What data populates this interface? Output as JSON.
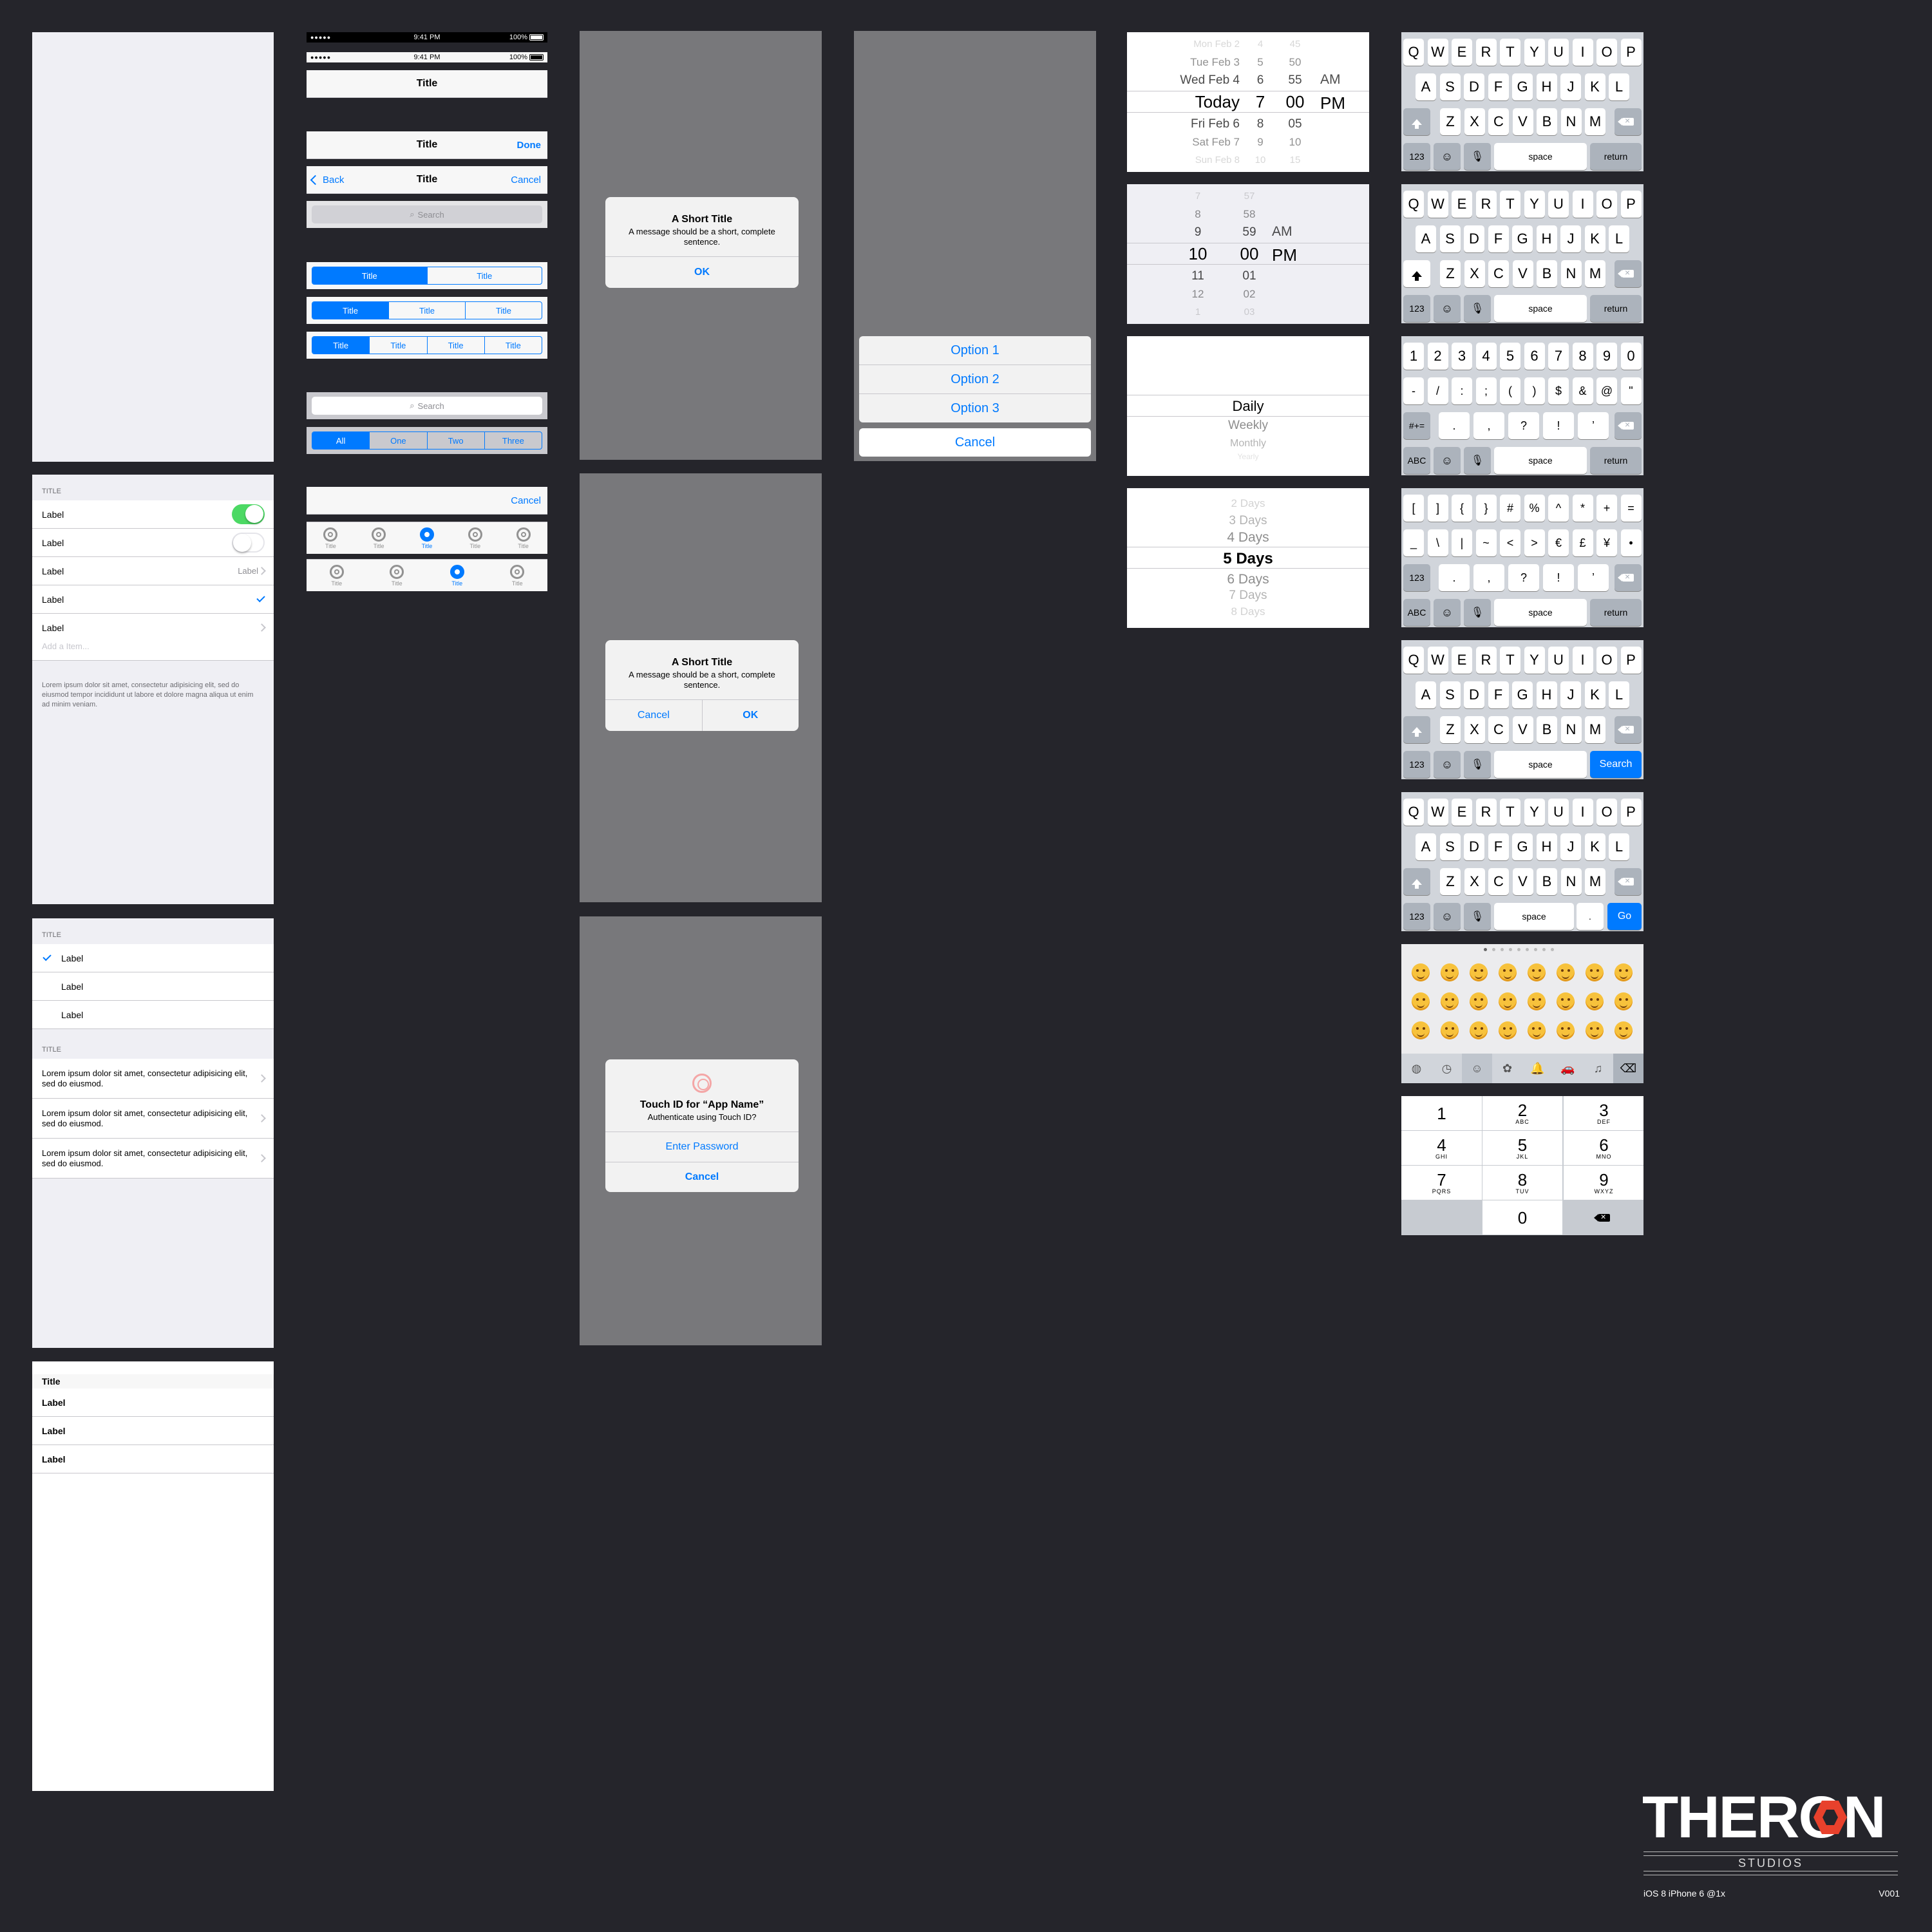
{
  "status": {
    "time": "9:41 PM",
    "battery": "100%",
    "signal": "●●●●●"
  },
  "nav": {
    "title": "Title",
    "done": "Done",
    "back": "Back",
    "cancel": "Cancel",
    "search": "Search"
  },
  "segments": {
    "two": [
      "Title",
      "Title"
    ],
    "three": [
      "Title",
      "Title",
      "Title"
    ],
    "four": [
      "Title",
      "Title",
      "Title",
      "Title"
    ],
    "scope": [
      "All",
      "One",
      "Two",
      "Three"
    ]
  },
  "tabs": {
    "label": "Title"
  },
  "toolbar_cancel": "Cancel",
  "table1": {
    "header": "TITLE",
    "rows": [
      "Label",
      "Label",
      "Label",
      "Label",
      "Label"
    ],
    "detail": "Label",
    "placeholder": "Add a Item...",
    "footer": "Lorem ipsum dolor sit amet, consectetur adipisicing elit, sed do eiusmod tempor incididunt ut labore et dolore magna aliqua ut enim ad minim veniam."
  },
  "table2": {
    "header1": "TITLE",
    "rows": [
      "Label",
      "Label",
      "Label"
    ],
    "header2": "TITLE",
    "long_rows": [
      "Lorem ipsum dolor sit amet, consectetur adipisicing elit, sed do eiusmod.",
      "Lorem ipsum dolor sit amet, consectetur adipisicing elit, sed do eiusmod.",
      "Lorem ipsum dolor sit amet, consectetur adipisicing elit, sed do eiusmod."
    ]
  },
  "table3": {
    "title": "Title",
    "rows": [
      "Label",
      "Label",
      "Label"
    ]
  },
  "alert1": {
    "title": "A Short Title",
    "message": "A message should be a short, complete sentence.",
    "ok": "OK"
  },
  "alert2": {
    "title": "A Short Title",
    "message": "A message should be a short, complete sentence.",
    "cancel": "Cancel",
    "ok": "OK"
  },
  "alert3": {
    "title": "Touch ID for “App Name”",
    "message": "Authenticate using Touch ID?",
    "enter_password": "Enter Password",
    "cancel": "Cancel"
  },
  "action_sheet": {
    "options": [
      "Option 1",
      "Option 2",
      "Option 3"
    ],
    "cancel": "Cancel"
  },
  "date_picker": {
    "dates": [
      "Mon Feb 2",
      "Tue Feb 3",
      "Wed Feb 4",
      "Today",
      "Fri Feb 6",
      "Sat Feb 7",
      "Sun Feb 8"
    ],
    "hours": [
      "4",
      "5",
      "6",
      "7",
      "8",
      "9",
      "10"
    ],
    "minutes": [
      "45",
      "50",
      "55",
      "00",
      "05",
      "10",
      "15"
    ],
    "ampm": [
      "AM",
      "PM"
    ]
  },
  "time_picker": {
    "hours": [
      "7",
      "8",
      "9",
      "10",
      "11",
      "12",
      "1"
    ],
    "minutes": [
      "57",
      "58",
      "59",
      "00",
      "01",
      "02",
      "03"
    ],
    "ampm": [
      "AM",
      "PM"
    ]
  },
  "list_picker": [
    "Daily",
    "Weekly",
    "Monthly",
    "Yearly"
  ],
  "days_picker": [
    "2 Days",
    "3 Days",
    "4 Days",
    "5 Days",
    "6 Days",
    "7 Days",
    "8 Days"
  ],
  "keyboard": {
    "row1": [
      "Q",
      "W",
      "E",
      "R",
      "T",
      "Y",
      "U",
      "I",
      "O",
      "P"
    ],
    "row2": [
      "A",
      "S",
      "D",
      "F",
      "G",
      "H",
      "J",
      "K",
      "L"
    ],
    "row3": [
      "Z",
      "X",
      "C",
      "V",
      "B",
      "N",
      "M"
    ],
    "num_row1": [
      "1",
      "2",
      "3",
      "4",
      "5",
      "6",
      "7",
      "8",
      "9",
      "0"
    ],
    "num_row2": [
      "-",
      "/",
      ":",
      ";",
      "(",
      ")",
      "$",
      "&",
      "@",
      "\""
    ],
    "num_row3": [
      ".",
      ",",
      "?",
      "!",
      "’"
    ],
    "sym_row1": [
      "[",
      "]",
      "{",
      "}",
      "#",
      "%",
      "^",
      "*",
      "+",
      "="
    ],
    "sym_row2": [
      "_",
      "\\",
      "|",
      "~",
      "<",
      ">",
      "€",
      "£",
      "¥",
      "•"
    ],
    "key_123": "123",
    "key_abc": "ABC",
    "key_symbols": "#+=",
    "space": "space",
    "return": "return",
    "search": "Search",
    "go": "Go",
    "dot": "."
  },
  "numpad": [
    {
      "n": "1",
      "s": ""
    },
    {
      "n": "2",
      "s": "ABC"
    },
    {
      "n": "3",
      "s": "DEF"
    },
    {
      "n": "4",
      "s": "GHI"
    },
    {
      "n": "5",
      "s": "JKL"
    },
    {
      "n": "6",
      "s": "MNO"
    },
    {
      "n": "7",
      "s": "PQRS"
    },
    {
      "n": "8",
      "s": "TUV"
    },
    {
      "n": "9",
      "s": "WXYZ"
    },
    {
      "n": "",
      "s": ""
    },
    {
      "n": "0",
      "s": ""
    },
    {
      "n": "",
      "s": ""
    }
  ],
  "brand": {
    "logo": "THERON",
    "sub": "STUDIOS",
    "caption": "iOS 8 iPhone 6 @1x",
    "version": "V001"
  },
  "colors": {
    "background": "#25252b",
    "tint": "#007aff",
    "switch_on": "#4cd964",
    "dim": "#78787b"
  }
}
